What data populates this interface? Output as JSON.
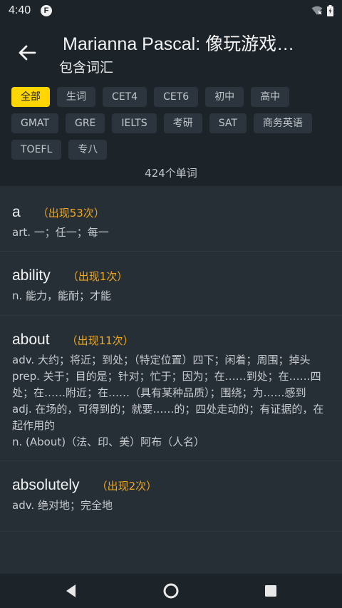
{
  "status": {
    "time": "4:40",
    "app_icon_letter": "F"
  },
  "header": {
    "title": "Marianna Pascal: 像玩游戏…",
    "subtitle": "包含词汇"
  },
  "filters": [
    [
      "全部",
      "生词",
      "CET4",
      "CET6",
      "初中",
      "高中"
    ],
    [
      "GMAT",
      "GRE",
      "IELTS",
      "考研",
      "SAT",
      "商务英语"
    ],
    [
      "TOEFL",
      "专八"
    ]
  ],
  "count_label": "424个单词",
  "words": [
    {
      "word": "a",
      "freq": "（出现53次）",
      "defs": [
        "art. 一；任一；每一"
      ]
    },
    {
      "word": "ability",
      "freq": "（出现1次）",
      "defs": [
        "n. 能力，能耐；才能"
      ]
    },
    {
      "word": "about",
      "freq": "（出现11次）",
      "defs": [
        "adv. 大约；将近；到处；（特定位置）四下；闲着；周围；掉头",
        "prep. 关于；目的是；针对；忙于；因为；在……到处；在……四处；在……附近；在……（具有某种品质）；围绕；为……感到",
        "adj. 在场的，可得到的；就要……的；四处走动的；有证据的，在起作用的",
        "n. (About)（法、印、美）阿布（人名）"
      ]
    },
    {
      "word": "absolutely",
      "freq": "（出现2次）",
      "defs": [
        "adv. 绝对地；完全地"
      ]
    }
  ],
  "colors": {
    "background": "#1c2329",
    "list_bg": "#262f36",
    "active_chip": "#ffd600",
    "freq": "#f0a81f"
  }
}
